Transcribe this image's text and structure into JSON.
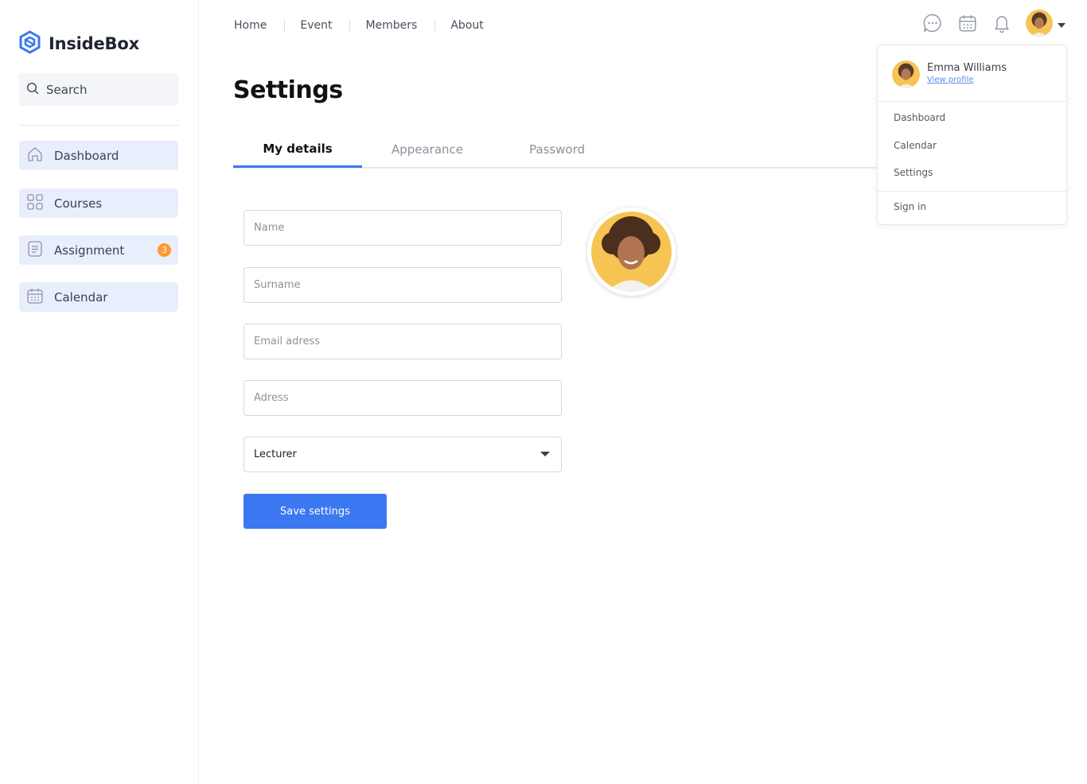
{
  "app": {
    "brand": "InsideBox"
  },
  "sidebar": {
    "search_placeholder": "Search",
    "items": [
      {
        "label": "Dashboard",
        "icon": "home-icon"
      },
      {
        "label": "Courses",
        "icon": "grid-icon"
      },
      {
        "label": "Assignment",
        "icon": "document-icon",
        "badge": "3"
      },
      {
        "label": "Calendar",
        "icon": "calendar-icon"
      }
    ]
  },
  "topnav": {
    "links": [
      "Home",
      "Event",
      "Members",
      "About"
    ]
  },
  "header_icons": [
    "chat-icon",
    "calendar-icon",
    "bell-icon",
    "avatar",
    "caret-down-icon"
  ],
  "page": {
    "title": "Settings",
    "tabs": [
      {
        "label": "My details",
        "active": true
      },
      {
        "label": "Appearance",
        "active": false
      },
      {
        "label": "Password",
        "active": false
      }
    ]
  },
  "form": {
    "name_placeholder": "Name",
    "surname_placeholder": "Surname",
    "email_placeholder": "Email adress",
    "address_placeholder": "Adress",
    "role_value": "Lecturer",
    "save_label": "Save settings"
  },
  "dropdown": {
    "user_name": "Emma Williams",
    "profile_link": "View profile",
    "items": [
      "Dashboard",
      "Calendar",
      "Settings"
    ],
    "signin": "Sign in"
  },
  "colors": {
    "accent": "#3b78f1",
    "badge": "#ff9b2b",
    "nav_bg": "#e9eefd"
  }
}
